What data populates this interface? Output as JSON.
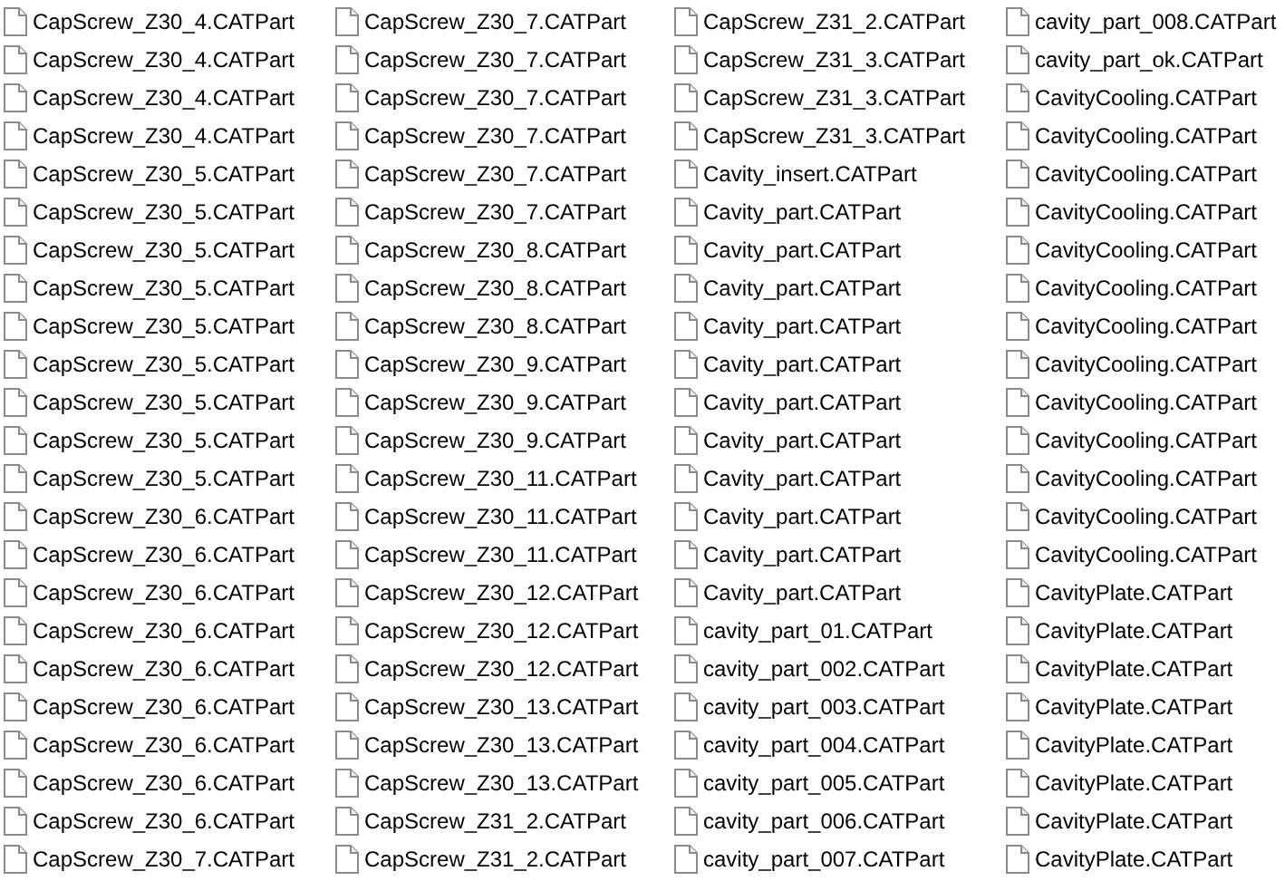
{
  "files": [
    "CapScrew_Z30_4.CATPart",
    "CapScrew_Z30_4.CATPart",
    "CapScrew_Z30_4.CATPart",
    "CapScrew_Z30_4.CATPart",
    "CapScrew_Z30_5.CATPart",
    "CapScrew_Z30_5.CATPart",
    "CapScrew_Z30_5.CATPart",
    "CapScrew_Z30_5.CATPart",
    "CapScrew_Z30_5.CATPart",
    "CapScrew_Z30_5.CATPart",
    "CapScrew_Z30_5.CATPart",
    "CapScrew_Z30_5.CATPart",
    "CapScrew_Z30_5.CATPart",
    "CapScrew_Z30_6.CATPart",
    "CapScrew_Z30_6.CATPart",
    "CapScrew_Z30_6.CATPart",
    "CapScrew_Z30_6.CATPart",
    "CapScrew_Z30_6.CATPart",
    "CapScrew_Z30_6.CATPart",
    "CapScrew_Z30_6.CATPart",
    "CapScrew_Z30_6.CATPart",
    "CapScrew_Z30_6.CATPart",
    "CapScrew_Z30_7.CATPart",
    "CapScrew_Z30_7.CATPart",
    "CapScrew_Z30_7.CATPart",
    "CapScrew_Z30_7.CATPart",
    "CapScrew_Z30_7.CATPart",
    "CapScrew_Z30_7.CATPart",
    "CapScrew_Z30_7.CATPart",
    "CapScrew_Z30_8.CATPart",
    "CapScrew_Z30_8.CATPart",
    "CapScrew_Z30_8.CATPart",
    "CapScrew_Z30_9.CATPart",
    "CapScrew_Z30_9.CATPart",
    "CapScrew_Z30_9.CATPart",
    "CapScrew_Z30_11.CATPart",
    "CapScrew_Z30_11.CATPart",
    "CapScrew_Z30_11.CATPart",
    "CapScrew_Z30_12.CATPart",
    "CapScrew_Z30_12.CATPart",
    "CapScrew_Z30_12.CATPart",
    "CapScrew_Z30_13.CATPart",
    "CapScrew_Z30_13.CATPart",
    "CapScrew_Z30_13.CATPart",
    "CapScrew_Z31_2.CATPart",
    "CapScrew_Z31_2.CATPart",
    "CapScrew_Z31_2.CATPart",
    "CapScrew_Z31_3.CATPart",
    "CapScrew_Z31_3.CATPart",
    "CapScrew_Z31_3.CATPart",
    "Cavity_insert.CATPart",
    "Cavity_part.CATPart",
    "Cavity_part.CATPart",
    "Cavity_part.CATPart",
    "Cavity_part.CATPart",
    "Cavity_part.CATPart",
    "Cavity_part.CATPart",
    "Cavity_part.CATPart",
    "Cavity_part.CATPart",
    "Cavity_part.CATPart",
    "Cavity_part.CATPart",
    "Cavity_part.CATPart",
    "cavity_part_01.CATPart",
    "cavity_part_002.CATPart",
    "cavity_part_003.CATPart",
    "cavity_part_004.CATPart",
    "cavity_part_005.CATPart",
    "cavity_part_006.CATPart",
    "cavity_part_007.CATPart",
    "cavity_part_008.CATPart",
    "cavity_part_ok.CATPart",
    "CavityCooling.CATPart",
    "CavityCooling.CATPart",
    "CavityCooling.CATPart",
    "CavityCooling.CATPart",
    "CavityCooling.CATPart",
    "CavityCooling.CATPart",
    "CavityCooling.CATPart",
    "CavityCooling.CATPart",
    "CavityCooling.CATPart",
    "CavityCooling.CATPart",
    "CavityCooling.CATPart",
    "CavityCooling.CATPart",
    "CavityCooling.CATPart",
    "CavityPlate.CATPart",
    "CavityPlate.CATPart",
    "CavityPlate.CATPart",
    "CavityPlate.CATPart",
    "CavityPlate.CATPart",
    "CavityPlate.CATPart",
    "CavityPlate.CATPart",
    "CavityPlate.CATPart"
  ]
}
